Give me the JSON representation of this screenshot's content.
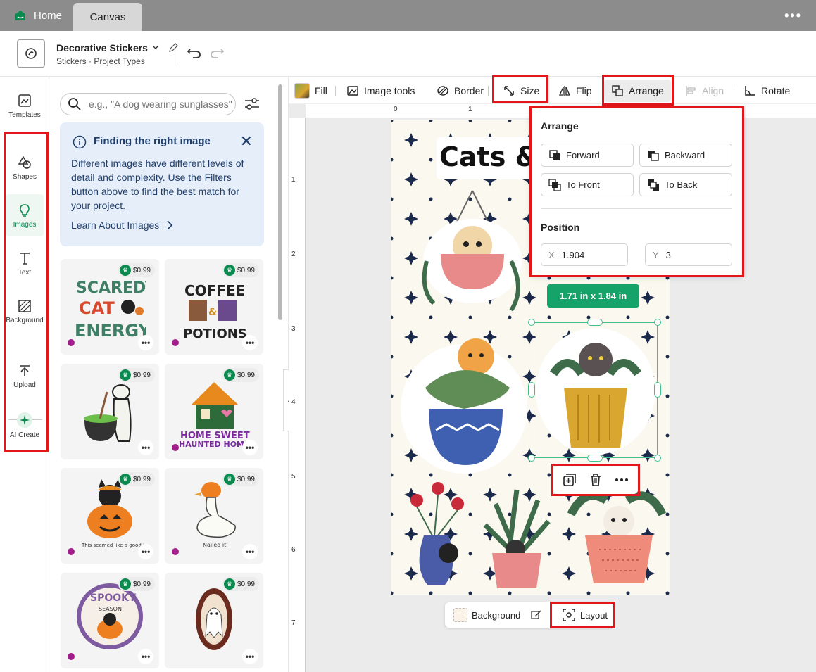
{
  "titlebar": {
    "home_label": "Home",
    "tab_label": "Canvas",
    "more": "•••"
  },
  "header": {
    "project_title": "Decorative Stickers",
    "project_sub": "Stickers  ·  Project Types"
  },
  "leftnav": {
    "items": [
      {
        "label": "Templates",
        "icon": "templates-icon"
      },
      {
        "label": "Shapes",
        "icon": "shapes-icon"
      },
      {
        "label": "Images",
        "icon": "lightbulb-icon"
      },
      {
        "label": "Text",
        "icon": "text-icon"
      },
      {
        "label": "Background",
        "icon": "background-icon"
      },
      {
        "label": "Upload",
        "icon": "upload-icon"
      },
      {
        "label": "AI Create",
        "icon": "sparkle-icon"
      }
    ]
  },
  "panel": {
    "search_placeholder": "e.g., \"A dog wearing sunglasses\"",
    "info": {
      "title": "Finding the right image",
      "body": "Different images have different levels of detail and complexity. Use the Filters button above to find the best match for your project.",
      "link": "Learn About Images"
    },
    "cards": [
      {
        "name": "scaredy-cat-energy",
        "price": "$0.99",
        "lines": [
          "SCAREDY",
          "CAT",
          "ENERGY"
        ]
      },
      {
        "name": "coffee-potions",
        "price": "$0.99",
        "lines": [
          "COFFEE",
          "&",
          "POTIONS"
        ]
      },
      {
        "name": "frog-cauldron",
        "price": "$0.99",
        "lines": []
      },
      {
        "name": "home-sweet-haunted-home",
        "price": "$0.99",
        "lines": [
          "HOME SWEET",
          "HAUNTED HOME"
        ]
      },
      {
        "name": "cat-pumpkin",
        "price": "$0.99",
        "lines": [
          "This seemed like a good idea."
        ]
      },
      {
        "name": "goose-pumpkin",
        "price": "$0.99",
        "lines": [
          "Nailed it"
        ]
      },
      {
        "name": "spooky-season",
        "price": "$0.99",
        "lines": [
          "SPOOKY",
          "SEASON"
        ]
      },
      {
        "name": "ghost-frame",
        "price": "$0.99",
        "lines": []
      }
    ],
    "card_more": "•••"
  },
  "toolbar": {
    "fill": "Fill",
    "image_tools": "Image tools",
    "border": "Border",
    "size": "Size",
    "flip": "Flip",
    "arrange": "Arrange",
    "align": "Align",
    "rotate": "Rotate"
  },
  "ruler": {
    "h": [
      "0",
      "1"
    ],
    "v": [
      "1",
      "2",
      "3",
      "4",
      "5",
      "6",
      "7"
    ]
  },
  "canvas": {
    "title": "Cats &",
    "dimensions": "1.71  in x 1.84  in"
  },
  "arrange_popup": {
    "heading": "Arrange",
    "forward": "Forward",
    "backward": "Backward",
    "to_front": "To Front",
    "to_back": "To Back",
    "position_heading": "Position",
    "x_label": "X",
    "x_value": "1.904",
    "y_label": "Y",
    "y_value": "3"
  },
  "bottombar": {
    "background": "Background",
    "layout": "Layout"
  },
  "colors": {
    "accent": "#0a8a4f",
    "highlight": "#e3161c",
    "selection": "#3fbf89"
  }
}
